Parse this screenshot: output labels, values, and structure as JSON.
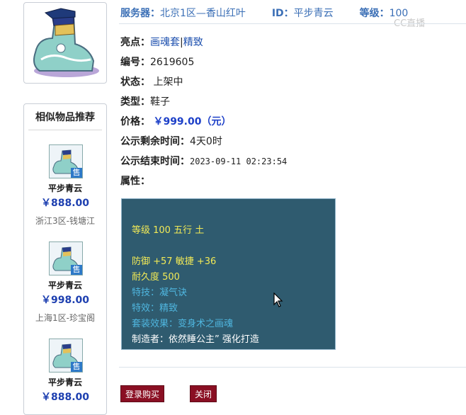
{
  "header": {
    "server_label": "服务器：",
    "server_value": "北京1区—香山红叶",
    "id_label": "ID：",
    "id_value": "平步青云",
    "level_label": "等级：",
    "level_value": "100",
    "watermark": "CC直播"
  },
  "details": {
    "highlight_label": "亮点：",
    "highlight_1": "画魂套",
    "highlight_sep": "|",
    "highlight_2": "精致",
    "number_label": "编号：",
    "number_value": "2619605",
    "status_label": "状态：",
    "status_value": "上架中",
    "type_label": "类型：",
    "type_value": "鞋子",
    "price_label": "价格：",
    "price_value": "￥999.00（元）",
    "remaining_label": "公示剩余时间：",
    "remaining_value": "4天0时",
    "end_label": "公示结束时间：",
    "end_value": "2023-09-11 02:23:54",
    "attr_label": "属性："
  },
  "attributes": {
    "level_element": "等级 100 五行 土",
    "defense_agility": "防御 +57 敏捷 +36",
    "durability": "耐久度 500",
    "skill": "特技：凝气诀",
    "effect": "特效：精致",
    "set_effect": "套装效果：变身术之画魂",
    "maker": "制造者：依然睡公主” 强化打造"
  },
  "similar": {
    "title": "相似物品推荐",
    "badge": "售",
    "items": [
      {
        "name": "平步青云",
        "price": "￥888.00",
        "server": "浙江3区-钱塘江"
      },
      {
        "name": "平步青云",
        "price": "￥998.00",
        "server": "上海1区-珍宝阁"
      },
      {
        "name": "平步青云",
        "price": "￥888.00",
        "server": ""
      }
    ]
  },
  "buttons": {
    "login_buy": "登录购买",
    "close": "关闭"
  },
  "colors": {
    "attr_bg": "#2f5b6f",
    "button_bg": "#8a0f23",
    "header_text": "#3b6fb6",
    "price_text": "#1c3fc8"
  },
  "icons": [
    "shoe-item-icon",
    "sell-badge-icon",
    "mouse-cursor-icon"
  ]
}
